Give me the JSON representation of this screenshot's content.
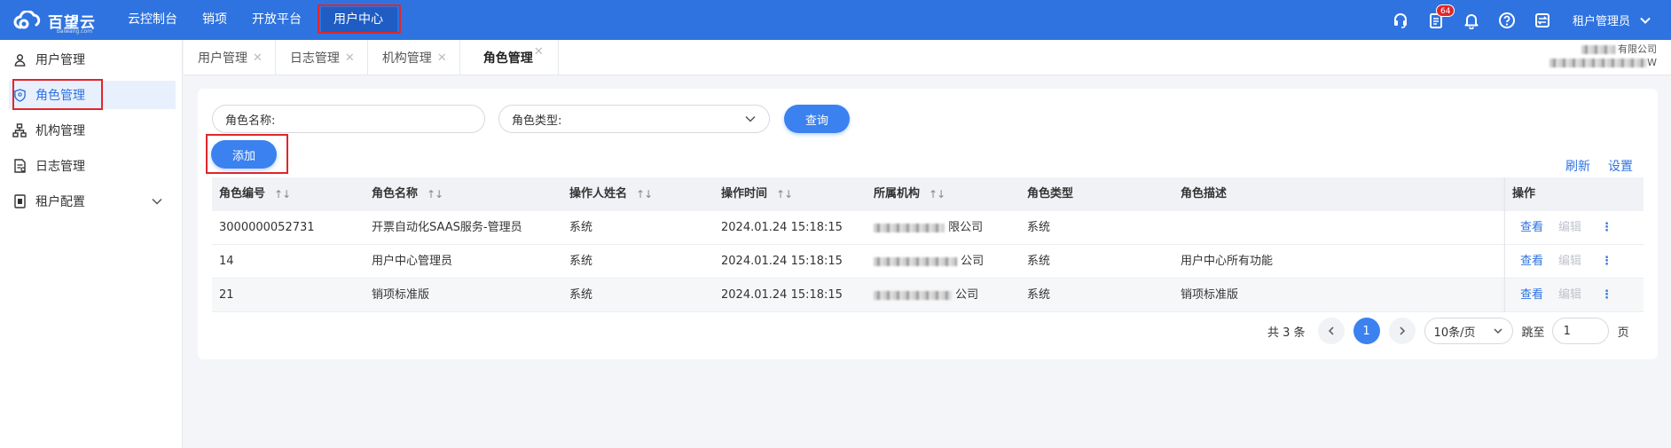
{
  "app": {
    "logo_text": "百望云",
    "logo_sub": "baiwang.com"
  },
  "topnav": {
    "items": [
      {
        "label": "云控制台"
      },
      {
        "label": "销项"
      },
      {
        "label": "开放平台"
      },
      {
        "label": "用户中心",
        "active": true
      }
    ]
  },
  "topbar_right": {
    "notification_count": "64",
    "user_label": "租户管理员"
  },
  "sidebar": {
    "items": [
      {
        "label": "用户管理",
        "icon": "user-icon"
      },
      {
        "label": "角色管理",
        "icon": "shield-icon",
        "active": true
      },
      {
        "label": "机构管理",
        "icon": "org-tree-icon"
      },
      {
        "label": "日志管理",
        "icon": "log-document-icon"
      },
      {
        "label": "租户配置",
        "icon": "settings-document-icon"
      }
    ]
  },
  "tabs": [
    {
      "label": "用户管理"
    },
    {
      "label": "日志管理"
    },
    {
      "label": "机构管理"
    },
    {
      "label": "角色管理",
      "active": true
    }
  ],
  "tenant_info": {
    "line1": "有限公司",
    "line2": "W"
  },
  "search": {
    "role_name_label": "角色名称:",
    "role_type_label": "角色类型:",
    "query_button": "查询",
    "add_button": "添加"
  },
  "table_actions": {
    "refresh": "刷新",
    "settings": "设置"
  },
  "table": {
    "columns": [
      "角色编号",
      "角色名称",
      "操作人姓名",
      "操作时间",
      "所属机构",
      "角色类型",
      "角色描述",
      "操作"
    ],
    "rows": [
      {
        "id": "3000000052731",
        "name": "开票自动化SAAS服务-管理员",
        "operator": "系统",
        "time": "2024.01.24 15:18:15",
        "org": "限公司",
        "type": "系统",
        "desc": "",
        "view": "查看",
        "edit": "编辑"
      },
      {
        "id": "14",
        "name": "用户中心管理员",
        "operator": "系统",
        "time": "2024.01.24 15:18:15",
        "org": "公司",
        "type": "系统",
        "desc": "用户中心所有功能",
        "view": "查看",
        "edit": "编辑"
      },
      {
        "id": "21",
        "name": "销项标准版",
        "operator": "系统",
        "time": "2024.01.24 15:18:15",
        "org": "公司",
        "type": "系统",
        "desc": "销项标准版",
        "view": "查看",
        "edit": "编辑"
      }
    ]
  },
  "pagination": {
    "total_text": "共 3 条",
    "current_page": "1",
    "page_size": "10条/页",
    "goto_label": "跳至",
    "goto_value": "1",
    "page_suffix": "页"
  },
  "colors": {
    "primary": "#2f73e0",
    "highlight_box": "#e0262b"
  }
}
